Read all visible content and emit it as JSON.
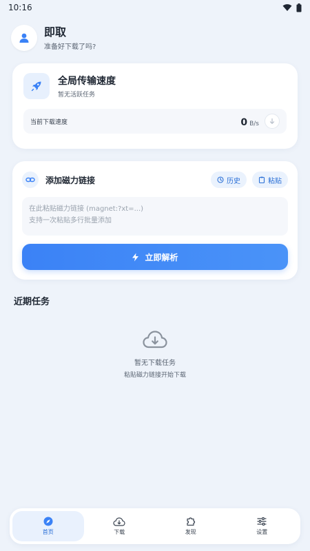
{
  "status_bar": {
    "time": "10:16"
  },
  "header": {
    "title": "即取",
    "subtitle": "准备好下载了吗?"
  },
  "speed_card": {
    "title": "全局传输速度",
    "subtitle": "暂无活跃任务",
    "label": "当前下载速度",
    "value": "0",
    "unit": "B/s"
  },
  "link_card": {
    "title": "添加磁力链接",
    "history_label": "历史",
    "paste_label": "粘贴",
    "placeholder": "在此粘贴磁力链接 (magnet:?xt=...)\n支持一次粘贴多行批量添加",
    "parse_label": "立即解析"
  },
  "recent": {
    "title": "近期任务",
    "empty_title": "暂无下载任务",
    "empty_sub": "粘贴磁力链接开始下载"
  },
  "nav": {
    "items": [
      {
        "label": "首页",
        "icon": "compass-icon",
        "active": true
      },
      {
        "label": "下载",
        "icon": "cloud-download-icon",
        "active": false
      },
      {
        "label": "发现",
        "icon": "puzzle-icon",
        "active": false
      },
      {
        "label": "设置",
        "icon": "sliders-icon",
        "active": false
      }
    ]
  },
  "colors": {
    "accent": "#3b82f6",
    "background": "#eef3fa"
  }
}
